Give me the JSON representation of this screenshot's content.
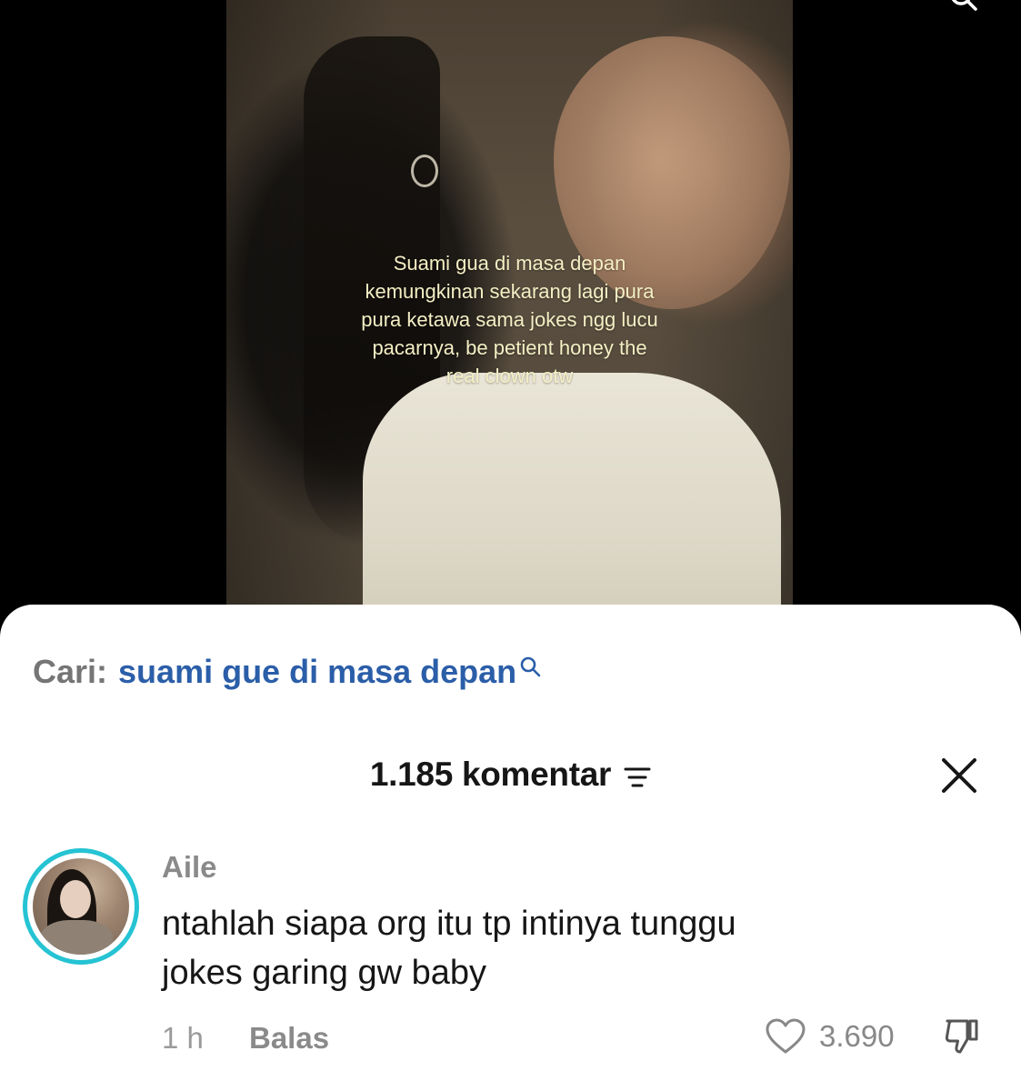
{
  "video": {
    "caption": "Suami gua di masa depan\nkemungkinan sekarang lagi pura\npura ketawa sama jokes ngg lucu\npacarnya, be petient honey the\nreal clown otw"
  },
  "search_suggestion": {
    "prefix": "Cari:",
    "query": "suami gue di masa depan",
    "icon": "search-icon"
  },
  "comments_header": {
    "count_label": "1.185 komentar",
    "filter_icon": "filter-icon",
    "close_icon": "close-icon"
  },
  "comments": [
    {
      "username": "Aile",
      "text": "ntahlah siapa org itu tp intinya tunggu\njokes garing gw baby",
      "time": "1 h",
      "reply_label": "Balas",
      "likes": "3.690",
      "avatar_ring_color": "#25c3d3"
    }
  ],
  "colors": {
    "search_query": "#2b5ea8",
    "avatar_ring": "#25c3d3",
    "caption_text": "#f4efc4"
  }
}
